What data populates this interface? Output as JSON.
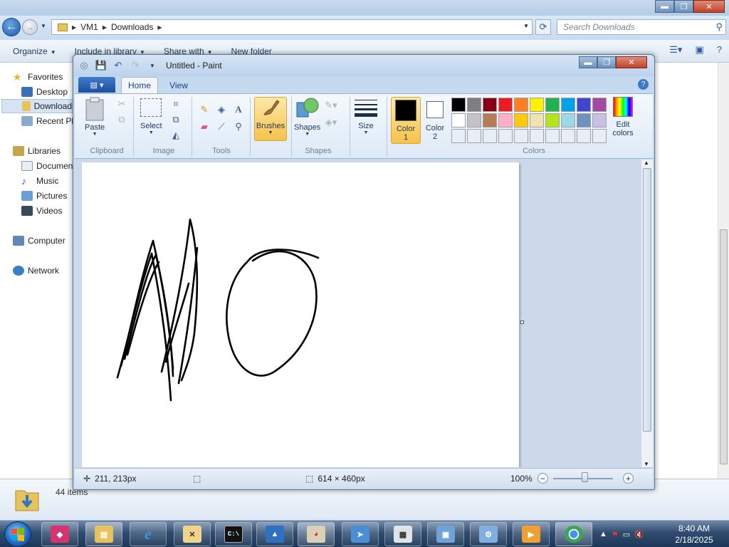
{
  "explorer": {
    "breadcrumb": [
      "VM1",
      "Downloads"
    ],
    "search_placeholder": "Search Downloads",
    "toolbar": {
      "organize": "Organize",
      "include": "Include in library",
      "share": "Share with",
      "new_folder": "New folder"
    },
    "nav": {
      "favorites": "Favorites",
      "desktop": "Desktop",
      "downloads": "Downloads",
      "recent": "Recent Places",
      "libraries": "Libraries",
      "documents": "Documents",
      "music": "Music",
      "pictures": "Pictures",
      "videos": "Videos",
      "computer": "Computer",
      "network": "Network"
    },
    "items_count": "44 items"
  },
  "paint": {
    "title": "Untitled - Paint",
    "tabs": {
      "home": "Home",
      "view": "View"
    },
    "ribbon": {
      "paste": "Paste",
      "select": "Select",
      "brushes": "Brushes",
      "shapes": "Shapes",
      "size": "Size",
      "color1": "Color 1",
      "color2": "Color 2",
      "edit_colors": "Edit colors",
      "groups": {
        "clipboard": "Clipboard",
        "image": "Image",
        "tools": "Tools",
        "shapes": "Shapes",
        "colors": "Colors"
      }
    },
    "color1_value": "#000000",
    "color2_value": "#ffffff",
    "palette": [
      "#000000",
      "#7f7f7f",
      "#880015",
      "#ed1c24",
      "#ff7f27",
      "#fff200",
      "#22b14c",
      "#00a2e8",
      "#3f48cc",
      "#a349a4",
      "#ffffff",
      "#c3c3c3",
      "#b97a57",
      "#ffaec9",
      "#ffc90e",
      "#efe4b0",
      "#b5e61d",
      "#99d9ea",
      "#7092be",
      "#c8bfe7",
      "#e8eef6",
      "#e8eef6",
      "#e8eef6",
      "#e8eef6",
      "#e8eef6",
      "#e8eef6",
      "#e8eef6",
      "#e8eef6",
      "#e8eef6",
      "#e8eef6"
    ],
    "status": {
      "cursor": "211, 213px",
      "canvas_size": "614 × 460px",
      "zoom": "100%"
    }
  },
  "taskbar": {
    "time": "8:40 AM",
    "date": "2/18/2025"
  }
}
